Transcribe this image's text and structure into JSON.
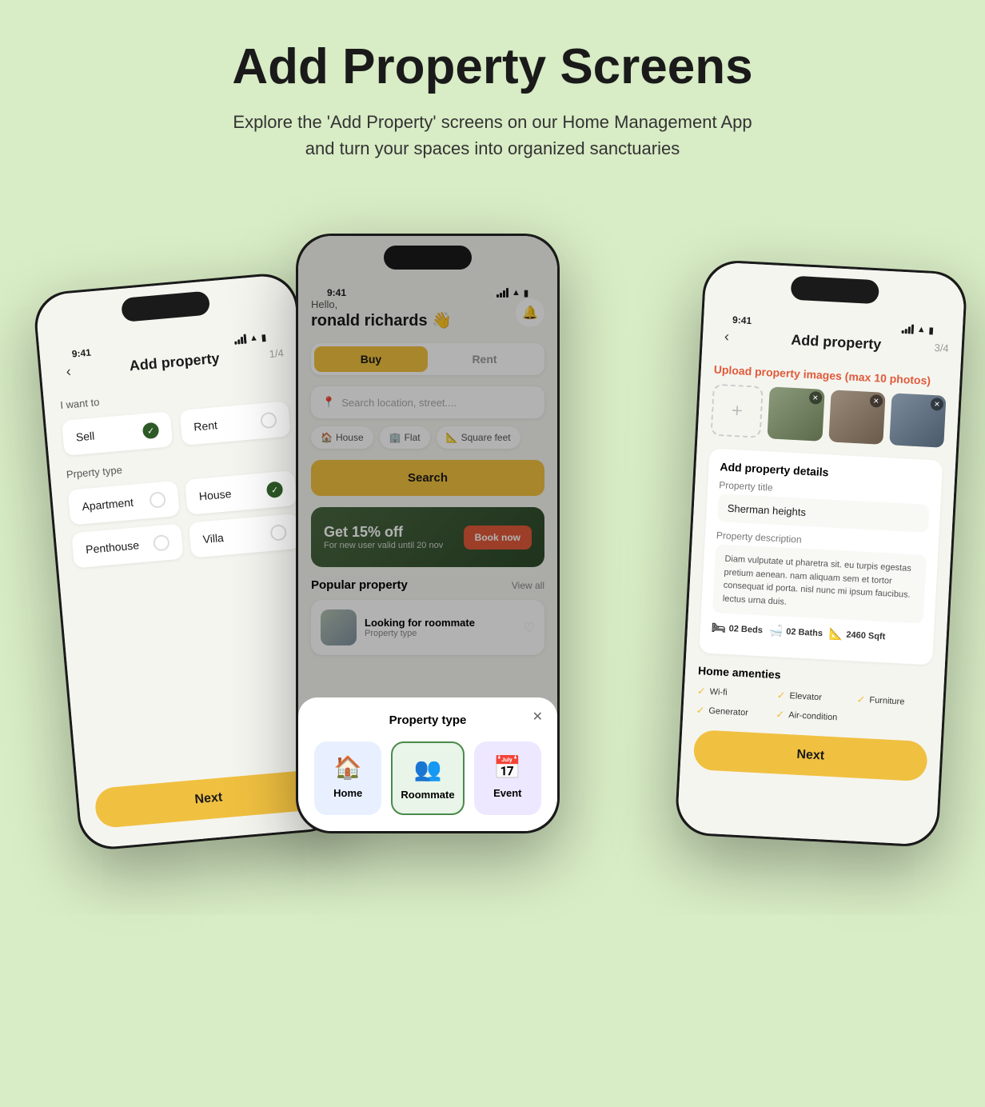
{
  "header": {
    "title": "Add Property Screens",
    "subtitle": "Explore the 'Add Property' screens on our Home Management App and turn your spaces into organized sanctuaries"
  },
  "phone_left": {
    "status_time": "9:41",
    "step": "1/4",
    "screen_title": "Add property",
    "want_to_label": "I want to",
    "sell_label": "Sell",
    "rent_label": "Rent",
    "property_type_label": "Prperty type",
    "types": [
      "Apartment",
      "House",
      "Penthouse",
      "Villa"
    ],
    "next_label": "Next",
    "sell_checked": true,
    "house_checked": true
  },
  "phone_center": {
    "status_time": "9:41",
    "hello": "Hello,",
    "user": "ronald richards 👋",
    "tab_buy": "Buy",
    "tab_rent": "Rent",
    "search_placeholder": "Search location, street....",
    "filters": [
      "House",
      "Flat",
      "Square feet"
    ],
    "search_btn": "Search",
    "promo_main": "Get 15% off",
    "promo_sub": "For new user valid until 20 nov",
    "book_btn": "Book now",
    "popular_title": "Popular property",
    "view_all": "View all",
    "looking_for": "Looking for roommate",
    "property_type_popup_title": "Property type",
    "popup_types": [
      "Home",
      "Roommate",
      "Event"
    ]
  },
  "phone_right": {
    "status_time": "9:41",
    "step": "3/4",
    "screen_title": "Add property",
    "upload_label": "Upload property images",
    "upload_max": "(max 10 photos)",
    "details_title": "Add property details",
    "property_title_label": "Property title",
    "property_title_value": "Sherman heights",
    "description_label": "Property description",
    "description_text": "Diam vulputate ut pharetra sit. eu turpis egestas pretium aenean. nam aliquam sem et tortor consequat id porta. nisl nunc mi ipsum faucibus. lectus urna duis.",
    "beds": "02 Beds",
    "baths": "02 Baths",
    "sqft": "2460 Sqft",
    "amenities_title": "Home amenties",
    "amenities": [
      "Wi-fi",
      "Elevator",
      "Furniture",
      "Generator",
      "Air-condition"
    ],
    "next_label": "Next"
  }
}
